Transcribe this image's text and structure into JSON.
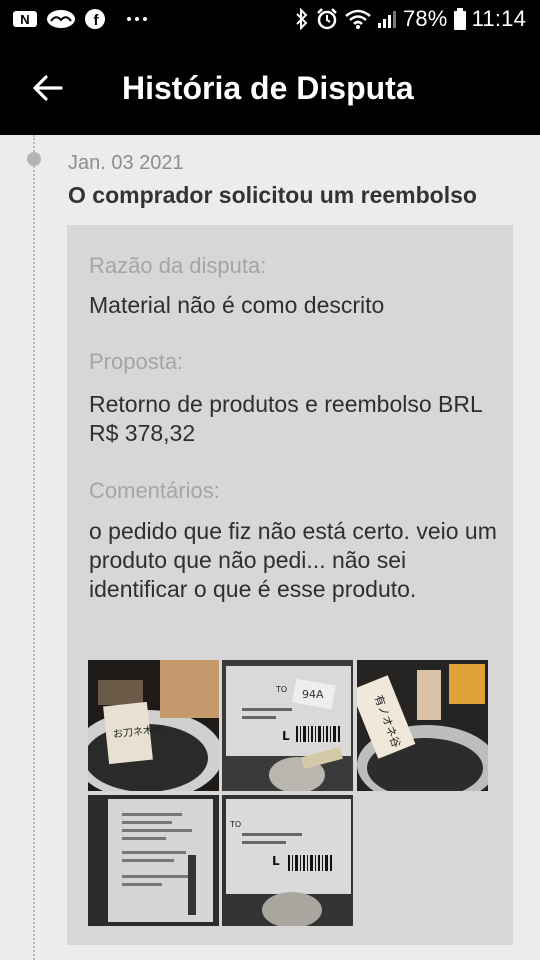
{
  "status_bar": {
    "battery_percent": "78%",
    "time": "11:14",
    "icons": [
      "netflix-icon",
      "deezer-icon",
      "facebook-icon",
      "more-notifications-icon",
      "bluetooth-icon",
      "alarm-icon",
      "wifi-icon",
      "signal-icon",
      "battery-icon"
    ]
  },
  "header": {
    "title": "História de Disputa",
    "back_icon": "arrow-left-icon"
  },
  "event": {
    "date": "Jan. 03 2021",
    "title": "O comprador solicitou um reembolso",
    "reason_label": "Razão da disputa:",
    "reason_value": "Material não é como descrito",
    "proposal_label": "Proposta:",
    "proposal_value": "Retorno de produtos e reembolso BRL R$ 378,32",
    "comments_label": "Comentários:",
    "comments_value": "o pedido que fiz não está certo. veio um produto que não pedi... não sei identificar o que é esse produto."
  },
  "photos": [
    {
      "name": "evidence-photo-1",
      "labels": [
        "お刀ネ木舎"
      ]
    },
    {
      "name": "evidence-photo-2",
      "labels": [
        "TO",
        "94A",
        "L"
      ]
    },
    {
      "name": "evidence-photo-3",
      "labels": [
        "有ノオネ谷"
      ]
    },
    {
      "name": "evidence-photo-4",
      "labels": []
    },
    {
      "name": "evidence-photo-5",
      "labels": [
        "TO",
        "L"
      ]
    }
  ]
}
